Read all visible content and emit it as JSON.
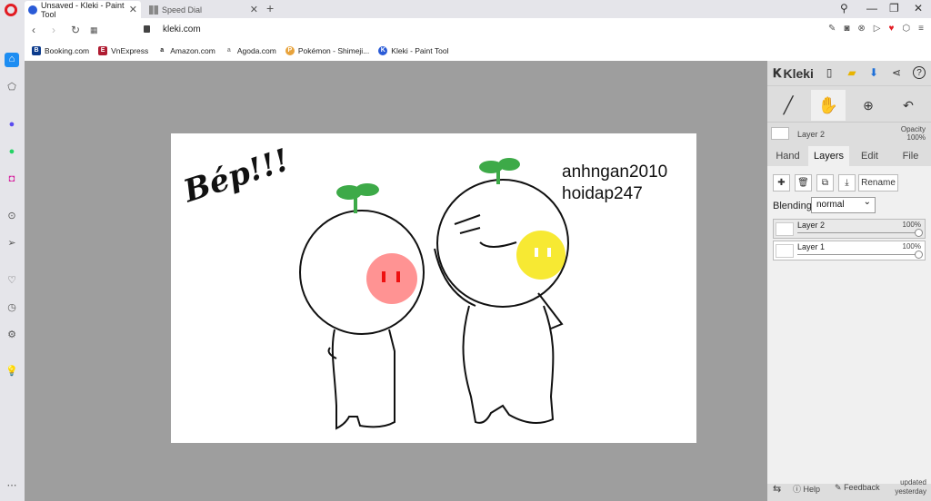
{
  "browser": {
    "tabs": [
      {
        "label": "Unsaved - Kleki - Paint Tool",
        "active": true
      },
      {
        "label": "Speed Dial",
        "active": false
      }
    ],
    "url": "kleki.com",
    "bookmarks": [
      {
        "label": "Booking.com",
        "icon": "B",
        "color": "#0c3b8c"
      },
      {
        "label": "VnExpress",
        "icon": "E",
        "color": "#b01c32"
      },
      {
        "label": "Amazon.com",
        "icon": "a",
        "color": "#222222"
      },
      {
        "label": "Agoda.com",
        "icon": "a",
        "color": "#888888"
      },
      {
        "label": "Pokémon - Shimeji...",
        "icon": "P",
        "color": "#e8a33c"
      },
      {
        "label": "Kleki - Paint Tool",
        "icon": "K",
        "color": "#2a5bd7"
      }
    ]
  },
  "kleki": {
    "logo": "Kleki",
    "current_layer": "Layer 2",
    "opacity_label": "Opacity",
    "opacity_value": "100%",
    "tabs": [
      "Hand",
      "Layers",
      "Edit",
      "File"
    ],
    "active_tab": "Layers",
    "rename_label": "Rename",
    "blending_label": "Blending",
    "blending_value": "normal",
    "layers": [
      {
        "name": "Layer 2",
        "opacity": "100%",
        "selected": true
      },
      {
        "name": "Layer 1",
        "opacity": "100%",
        "selected": false
      }
    ],
    "help_label": "Help",
    "feedback_label": "Feedback",
    "updated_label": "updated",
    "updated_when": "yesterday"
  },
  "drawing": {
    "caption_left": "Bép!!!",
    "caption_right_1": "anhngan2010",
    "caption_right_2": "hoidap247"
  },
  "colors": {
    "accent": "#1d8df2",
    "canvas_bg": "#9e9e9e",
    "leaf": "#3daa48",
    "blush_red": "#ff3b3b",
    "blush_yellow": "#f5e400"
  }
}
